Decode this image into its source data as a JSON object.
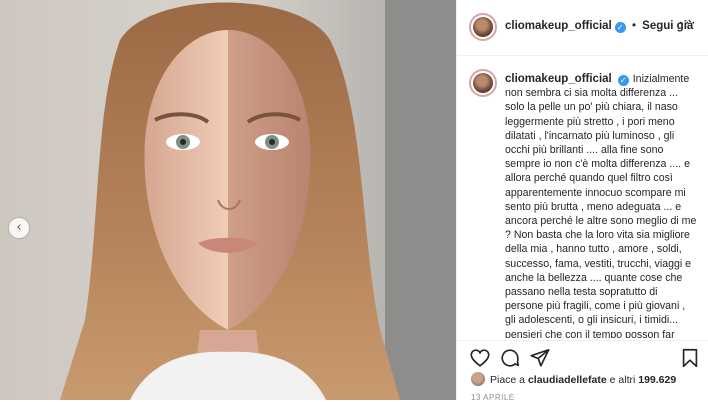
{
  "post": {
    "username": "cliomakeup_official",
    "follow_label": "Segui già",
    "separator": "•",
    "more_label": "···",
    "caption": "Inizialmente non sembra ci sia molta differenza ... solo la pelle un po' più chiara, il naso leggermente più stretto , i pori meno dilatati , l'incarnato più luminoso , gli occhi più brillanti .... alla fine sono sempre io non c'è molta differenza .... e allora perché quando quel filtro così apparentemente innocuo scompare mi sento più brutta , meno adeguata ... e ancora perché le altre sono meglio di me ? Non basta che la loro vita sia migliore della mia , hanno tutto , amore , soldi, successo, fama, vestiti, trucchi, viaggi e anche la bellezza .... quante cose che passano nella testa sopratutto di persone più fragili, come i più giovani , gli adolescenti, o gli insicuri, i timidi... pensieri che con il tempo posson far male , tanto male ...",
    "likes_prefix": "Piace a ",
    "liked_by": "claudiadellefate",
    "likes_suffix": " e altri ",
    "likes_count": "199.629",
    "date": "13 APRILE"
  },
  "photo": {
    "prev_arrow": "‹"
  },
  "icons": {
    "verified": "verified-badge-icon",
    "like": "heart-icon",
    "comment": "comment-icon",
    "share": "paper-plane-icon",
    "save": "bookmark-icon",
    "prev": "chevron-left-icon"
  },
  "colors": {
    "verified": "#3897f0",
    "text": "#262626",
    "muted": "#8e8e8e",
    "story_ring": "#d9a4a8"
  }
}
